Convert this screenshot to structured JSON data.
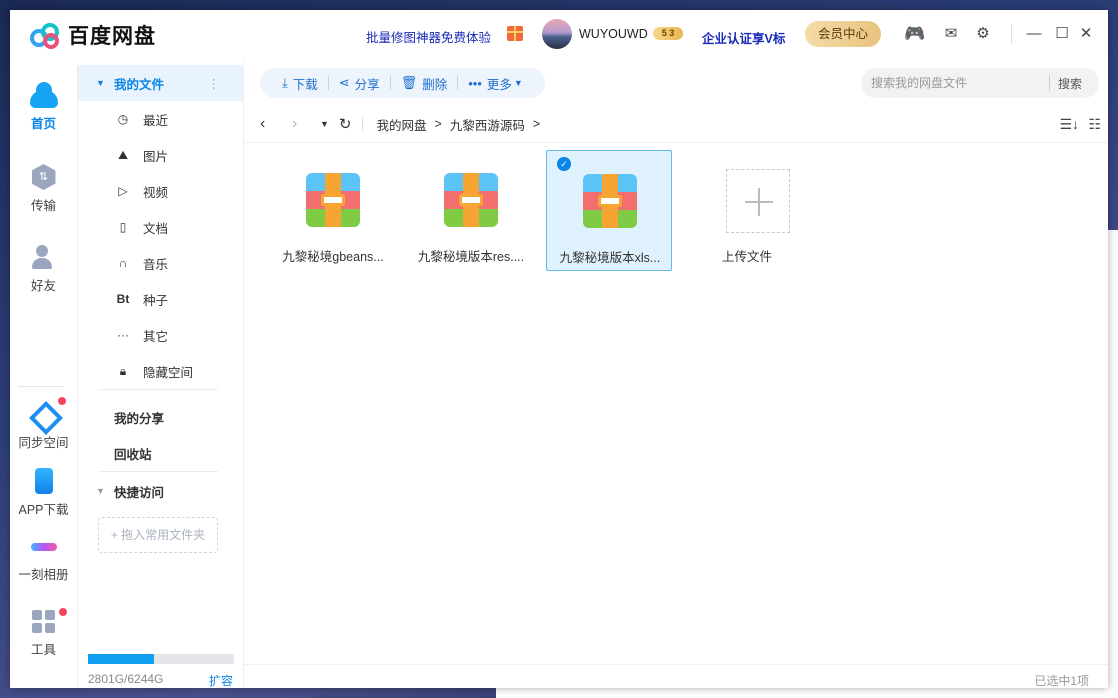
{
  "app": {
    "title": "百度网盘",
    "promo": "批量修图神器免费体验",
    "username": "WUYOUWD",
    "level": "5",
    "level2": "3",
    "enterprise": "企业认证享V标",
    "vip_center": "会员中心"
  },
  "leftnav": {
    "home": "首页",
    "transfer": "传输",
    "friends": "好友",
    "sync": "同步空间",
    "app_download": "APP下载",
    "moments": "一刻相册",
    "tools": "工具"
  },
  "tree": {
    "my_files": "我的文件",
    "items": [
      "最近",
      "图片",
      "视频",
      "文档",
      "音乐",
      "种子",
      "其它",
      "隐藏空间"
    ],
    "my_share": "我的分享",
    "recycle": "回收站",
    "quick_access": "快捷访问",
    "add_folder": "+ 拖入常用文件夹",
    "storage": "2801G/6244G",
    "storage_used_fraction": 0.449,
    "expand": "扩容"
  },
  "toolbar": {
    "download": "下载",
    "share": "分享",
    "delete": "删除",
    "more": "更多"
  },
  "search": {
    "placeholder": "搜索我的网盘文件",
    "button": "搜索"
  },
  "breadcrumb": {
    "root": "我的网盘",
    "current": "九黎西游源码"
  },
  "files": [
    {
      "name": "九黎秘境gbeans...",
      "selected": false
    },
    {
      "name": "九黎秘境版本res....",
      "selected": false
    },
    {
      "name": "九黎秘境版本xls...",
      "selected": true
    }
  ],
  "upload_label": "上传文件",
  "status": "已选中1项"
}
